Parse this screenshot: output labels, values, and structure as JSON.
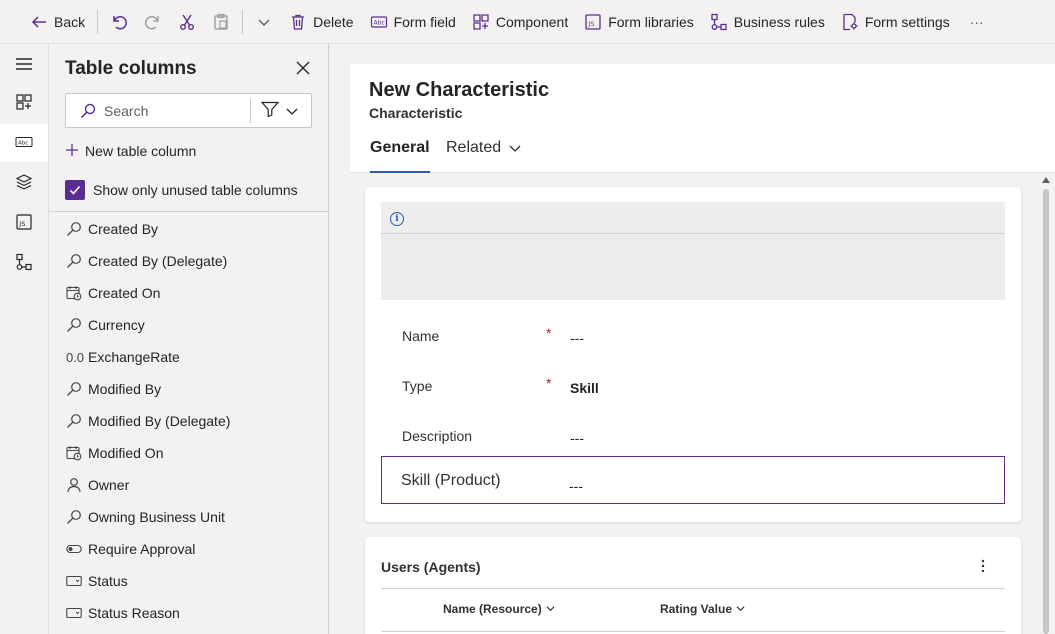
{
  "toolbar": {
    "back_label": "Back",
    "delete_label": "Delete",
    "form_field_label": "Form field",
    "component_label": "Component",
    "form_libraries_label": "Form libraries",
    "business_rules_label": "Business rules",
    "form_settings_label": "Form settings",
    "more_label": "···"
  },
  "rail": {
    "items": [
      "hamburger-icon",
      "components-icon",
      "table-columns-icon",
      "tree-view-icon",
      "form-libraries-icon",
      "business-rules-icon"
    ],
    "active_item": "table-columns-icon"
  },
  "panel": {
    "title": "Table columns",
    "search_placeholder": "Search",
    "new_column_label": "New table column",
    "unused_label": "Show only unused table columns",
    "unused_checked": true,
    "columns": [
      {
        "label": "Created By",
        "icon": "lookup-icon"
      },
      {
        "label": "Created By (Delegate)",
        "icon": "lookup-icon"
      },
      {
        "label": "Created On",
        "icon": "calendar-icon"
      },
      {
        "label": "Currency",
        "icon": "lookup-icon"
      },
      {
        "label": "ExchangeRate",
        "icon": "decimal-icon",
        "glyph": "0.0"
      },
      {
        "label": "Modified By",
        "icon": "lookup-icon"
      },
      {
        "label": "Modified By (Delegate)",
        "icon": "lookup-icon"
      },
      {
        "label": "Modified On",
        "icon": "calendar-icon"
      },
      {
        "label": "Owner",
        "icon": "person-icon"
      },
      {
        "label": "Owning Business Unit",
        "icon": "lookup-icon"
      },
      {
        "label": "Require Approval",
        "icon": "toggle-icon"
      },
      {
        "label": "Status",
        "icon": "option-set-icon"
      },
      {
        "label": "Status Reason",
        "icon": "option-set-icon"
      }
    ]
  },
  "form": {
    "title": "New Characteristic",
    "subtitle": "Characteristic",
    "tabs": [
      {
        "label": "General",
        "active": true
      },
      {
        "label": "Related",
        "active": false
      }
    ],
    "fields": [
      {
        "label": "Name",
        "required": true,
        "required_mark": "*",
        "value": "---",
        "bold": false
      },
      {
        "label": "Type",
        "required": true,
        "required_mark": "*",
        "value": "Skill",
        "bold": true
      },
      {
        "label": "Description",
        "required": false,
        "required_mark": "",
        "value": "---",
        "bold": false
      },
      {
        "label": "Skill (Product)",
        "required": false,
        "required_mark": "",
        "value": "---",
        "bold": false,
        "selected": true
      }
    ],
    "subgrid": {
      "title": "Users (Agents)",
      "columns": [
        "Name (Resource)",
        "Rating Value"
      ]
    }
  },
  "colors": {
    "accent": "#5c2d91",
    "tab_underline": "#2f5bb7",
    "required": "#a4262c",
    "info": "#2f5bb7"
  }
}
